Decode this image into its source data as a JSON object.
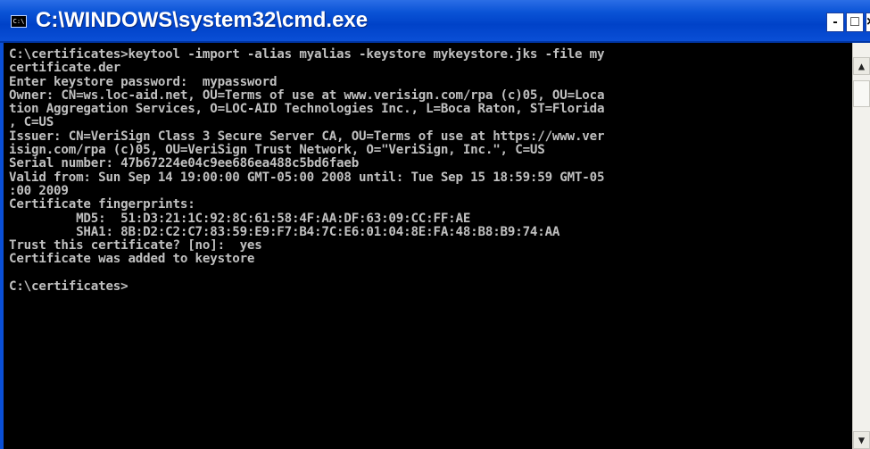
{
  "window": {
    "title": "C:\\WINDOWS\\system32\\cmd.exe",
    "icon_text": "C:\\",
    "minimize_label": "-",
    "maximize_label": "□",
    "close_label": "×",
    "titlebar_color": "#0a4fd6"
  },
  "console": {
    "text_color": "#c0c0c0",
    "background": "#000000",
    "lines": [
      "C:\\certificates>keytool -import -alias myalias -keystore mykeystore.jks -file my",
      "certificate.der",
      "Enter keystore password:  mypassword",
      "Owner: CN=ws.loc-aid.net, OU=Terms of use at www.verisign.com/rpa (c)05, OU=Loca",
      "tion Aggregation Services, O=LOC-AID Technologies Inc., L=Boca Raton, ST=Florida",
      ", C=US",
      "Issuer: CN=VeriSign Class 3 Secure Server CA, OU=Terms of use at https://www.ver",
      "isign.com/rpa (c)05, OU=VeriSign Trust Network, O=\"VeriSign, Inc.\", C=US",
      "Serial number: 47b67224e04c9ee686ea488c5bd6faeb",
      "Valid from: Sun Sep 14 19:00:00 GMT-05:00 2008 until: Tue Sep 15 18:59:59 GMT-05",
      ":00 2009",
      "Certificate fingerprints:",
      "         MD5:  51:D3:21:1C:92:8C:61:58:4F:AA:DF:63:09:CC:FF:AE",
      "         SHA1: 8B:D2:C2:C7:83:59:E9:F7:B4:7C:E6:01:04:8E:FA:48:B8:B9:74:AA",
      "Trust this certificate? [no]:  yes",
      "Certificate was added to keystore",
      "",
      "C:\\certificates>"
    ]
  },
  "scrollbar": {
    "up_icon": "▲",
    "down_icon": "▼"
  }
}
